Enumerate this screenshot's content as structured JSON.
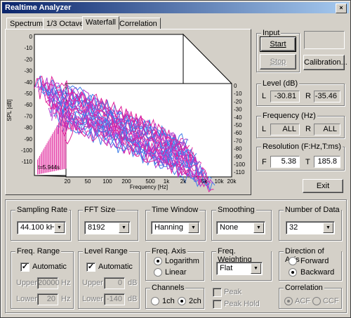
{
  "window": {
    "title": "Realtime Analyzer",
    "close_glyph": "×"
  },
  "tabs": [
    {
      "label": "Spectrum"
    },
    {
      "label": "1/3 Octave"
    },
    {
      "label": "Waterfall"
    },
    {
      "label": "Correlation"
    }
  ],
  "chart": {
    "ylabel": "SPL [dB]",
    "xlabel": "Frequency [Hz]",
    "y_ticks": [
      "0",
      "-10",
      "-20",
      "-30",
      "-40",
      "-50",
      "-60",
      "-70",
      "-80",
      "-90",
      "-100",
      "-110"
    ],
    "x_ticks": [
      "20",
      "50",
      "100",
      "200",
      "500",
      "1k",
      "2k",
      "5k",
      "10k",
      "20k"
    ],
    "z_ticks": [
      "0",
      "-10",
      "-20",
      "-30",
      "-40",
      "-50",
      "-60",
      "-70",
      "-80",
      "-90",
      "-100",
      "-110"
    ],
    "time_label": "t=5.944s",
    "colors": [
      "#e0209a",
      "#3d7de8",
      "#b23cd0"
    ]
  },
  "input": {
    "group": "Input",
    "start": "Start",
    "stop": "Stop",
    "calibration": "Calibration..."
  },
  "level": {
    "group": "Level (dB)",
    "l_label": "L",
    "l_value": "-30.81",
    "r_label": "R",
    "r_value": "-35.46"
  },
  "frequency": {
    "group": "Frequency (Hz)",
    "l_label": "L",
    "l_value": "ALL",
    "r_label": "R",
    "r_value": "ALL"
  },
  "resolution": {
    "group": "Resolution (F:Hz,T:ms)",
    "f_label": "F",
    "f_value": "5.38",
    "t_label": "T",
    "t_value": "185.8"
  },
  "exit": "Exit",
  "sampling_rate": {
    "group": "Sampling Rate",
    "value": "44.100 kHz"
  },
  "fft_size": {
    "group": "FFT Size",
    "value": "8192"
  },
  "time_window": {
    "group": "Time Window",
    "value": "Hanning"
  },
  "smoothing": {
    "group": "Smoothing",
    "value": "None"
  },
  "number_of_data": {
    "group": "Number of Data",
    "value": "32"
  },
  "freq_range": {
    "group": "Freq. Range",
    "automatic": "Automatic",
    "upper_label": "Upper",
    "upper_value": "20000",
    "upper_unit": "Hz",
    "lower_label": "Lower",
    "lower_value": "20",
    "lower_unit": "Hz"
  },
  "level_range": {
    "group": "Level Range",
    "automatic": "Automatic",
    "upper_label": "Upper",
    "upper_value": "0",
    "upper_unit": "dB",
    "lower_label": "Lower",
    "lower_value": "-140",
    "lower_unit": "dB"
  },
  "freq_axis": {
    "group": "Freq. Axis",
    "logarithm": "Logarithm",
    "linear": "Linear"
  },
  "freq_weighting": {
    "group": "Freq. Weighting",
    "value": "Flat"
  },
  "direction": {
    "group": "Direction of Axis",
    "forward": "Forward",
    "backward": "Backward"
  },
  "channels": {
    "group": "Channels",
    "ch1": "1ch",
    "ch2": "2ch"
  },
  "peak": {
    "peak": "Peak",
    "peak_hold": "Peak Hold"
  },
  "correlation": {
    "group": "Correlation",
    "acf": "ACF",
    "ccf": "CCF"
  },
  "check_glyph": "✓",
  "arrow_glyph": "▼"
}
